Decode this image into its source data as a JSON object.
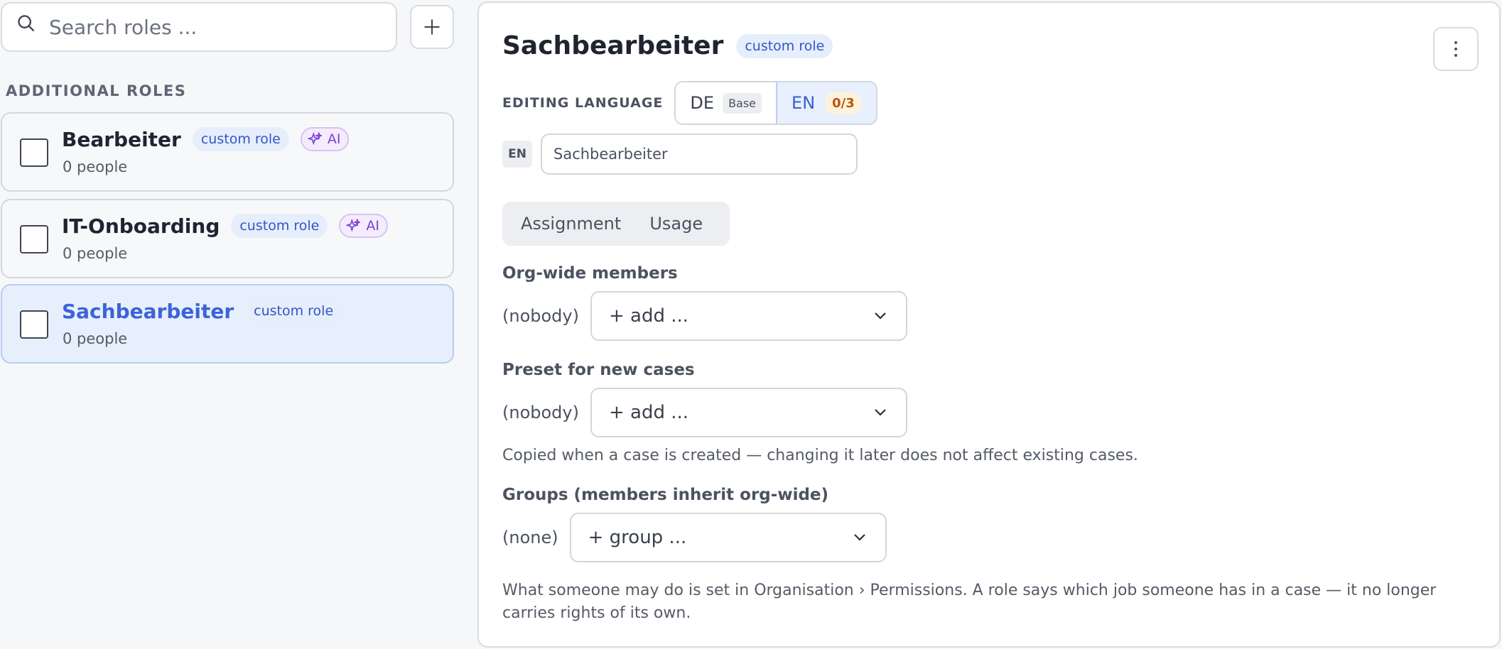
{
  "search": {
    "placeholder": "Search roles ..."
  },
  "sidebar": {
    "section_label": "ADDITIONAL ROLES",
    "roles": [
      {
        "name": "Bearbeiter",
        "badge": "custom role",
        "ai_badge": "AI",
        "people": "0 people"
      },
      {
        "name": "IT-Onboarding",
        "badge": "custom role",
        "ai_badge": "AI",
        "people": "0 people"
      },
      {
        "name": "Sachbearbeiter",
        "badge": "custom role",
        "people": "0 people",
        "selected": true
      }
    ]
  },
  "detail": {
    "title": "Sachbearbeiter",
    "badge": "custom role",
    "editing_language_label": "EDITING LANGUAGE",
    "languages": [
      {
        "code": "DE",
        "sub": "Base"
      },
      {
        "code": "EN",
        "count": "0/3",
        "active": true
      }
    ],
    "name_lang_tag": "EN",
    "name_value": "Sachbearbeiter",
    "tabs": [
      "Assignment",
      "Usage"
    ],
    "org_wide": {
      "label": "Org-wide members",
      "empty": "(nobody)",
      "dropdown": "+ add ..."
    },
    "preset": {
      "label": "Preset for new cases",
      "empty": "(nobody)",
      "dropdown": "+ add ...",
      "help": "Copied when a case is created — changing it later does not affect existing cases."
    },
    "groups": {
      "label": "Groups (members inherit org-wide)",
      "empty": "(none)",
      "dropdown": "+ group ..."
    },
    "footer_note": "What someone may do is set in Organisation › Permissions. A role says which job someone has in a case — it no longer carries rights of its own."
  },
  "colors": {
    "accent": "#3d63d6",
    "selected_bg": "#e7effd",
    "ai": "#7b3fd6"
  },
  "icons": [
    "search-icon",
    "plus-icon",
    "sparkle-icon",
    "kebab-icon",
    "chevron-down-icon"
  ]
}
